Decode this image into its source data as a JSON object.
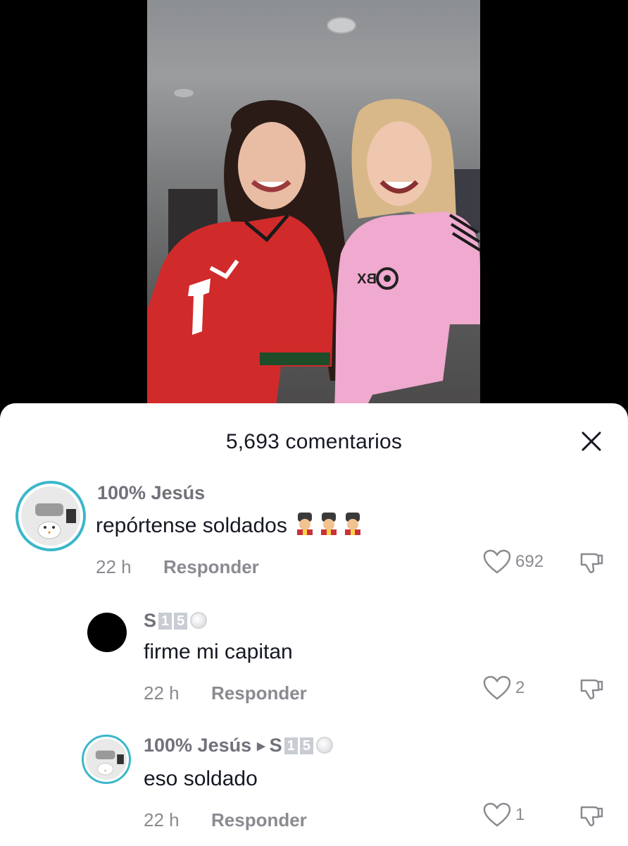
{
  "video": {
    "jersey_left_number": "7",
    "jersey_right_sponsor": "BX"
  },
  "sheet": {
    "title": "5,693 comentarios"
  },
  "comments": [
    {
      "username": "100% Jesús",
      "text": "repórtense soldados",
      "emoji": [
        "guard-emoji",
        "guard-emoji",
        "guard-emoji"
      ],
      "time": "22 h",
      "reply_label": "Responder",
      "likes": "692"
    },
    {
      "username": "S",
      "username_tags": [
        "1",
        "5"
      ],
      "text": "firme mi capitan",
      "time": "22 h",
      "reply_label": "Responder",
      "likes": "2"
    },
    {
      "username": "100% Jesús",
      "reply_to": "S",
      "reply_to_tags": [
        "1",
        "5"
      ],
      "text": "eso soldado",
      "time": "22 h",
      "reply_label": "Responder",
      "likes": "1"
    }
  ],
  "colors": {
    "avatar_ring": "#3bb7c9",
    "text_primary": "#161823",
    "text_secondary": "#8a8b91",
    "username": "#70717a"
  }
}
